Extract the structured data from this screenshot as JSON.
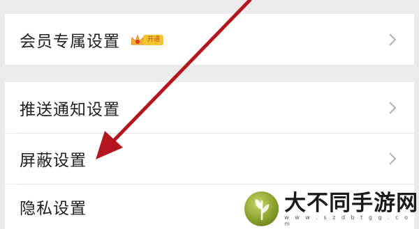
{
  "settings": {
    "items": [
      {
        "label": "会员专属设置",
        "badge": "开通",
        "icon": "chevron-right-icon"
      },
      {
        "label": "推送通知设置",
        "icon": "chevron-right-icon"
      },
      {
        "label": "屏蔽设置",
        "icon": "chevron-right-icon"
      },
      {
        "label": "隐私设置"
      }
    ]
  },
  "annotation": {
    "arrow_color": "#b3161e"
  },
  "watermark": {
    "brand": "大不同手游网",
    "url": "w w w . s z d b t g g . c o m"
  }
}
